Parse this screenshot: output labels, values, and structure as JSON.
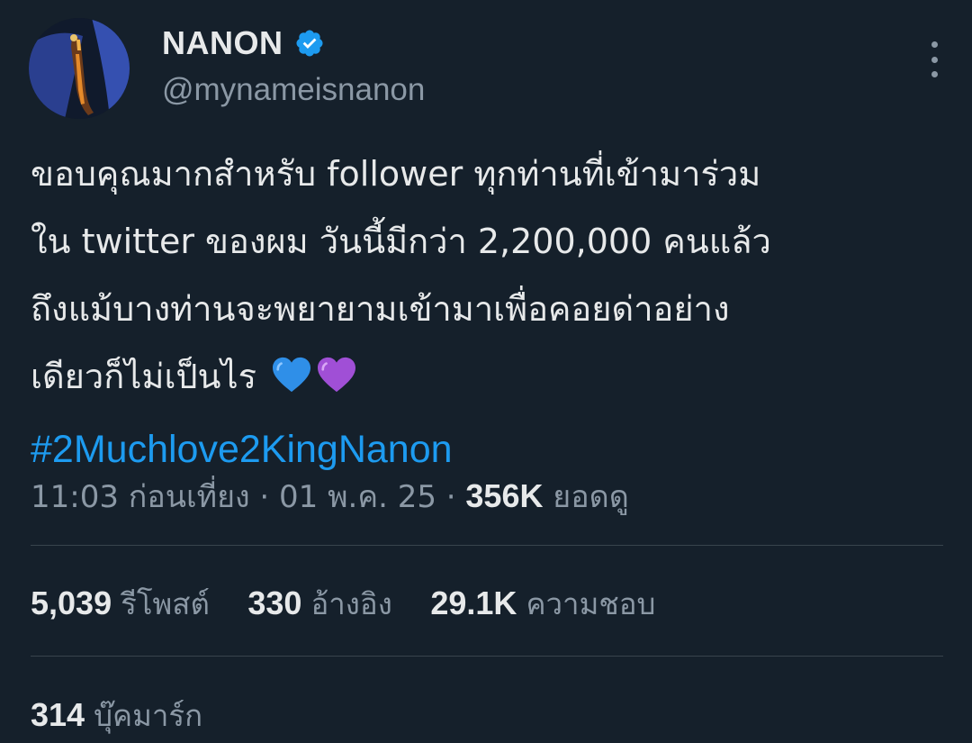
{
  "author": {
    "display_name": "NANON",
    "handle": "@mynameisnanon",
    "verified": true
  },
  "tweet": {
    "lines": [
      "ขอบคุณมากสำหรับ follower ทุกท่านที่เข้ามาร่วม",
      "ใน twitter ของผม วันนี้มีกว่า 2,200,000 คนแล้ว",
      "ถึงแม้บางท่านจะพยายามเข้ามาเพื่อคอยด่าอย่าง",
      "เดียวก็ไม่เป็นไร"
    ],
    "emojis": [
      "blue-heart",
      "purple-heart"
    ],
    "hashtag": "#2Muchlove2KingNanon"
  },
  "meta": {
    "time": "11:03 ก่อนเที่ยง",
    "date": "01 พ.ค. 25",
    "views_count": "356K",
    "views_label": "ยอดดู"
  },
  "stats": {
    "retweets": {
      "count": "5,039",
      "label": "รีโพสต์"
    },
    "quotes": {
      "count": "330",
      "label": "อ้างอิง"
    },
    "likes": {
      "count": "29.1K",
      "label": "ความชอบ"
    },
    "bookmarks": {
      "count": "314",
      "label": "บุ๊คมาร์ก"
    }
  },
  "colors": {
    "background": "#15202b",
    "text": "#e7e9ea",
    "secondary": "#8b98a5",
    "accent": "#1d9bf0",
    "divider": "#38444d"
  },
  "icons": {
    "verified": "verified-badge-icon",
    "more": "more-options-icon"
  }
}
